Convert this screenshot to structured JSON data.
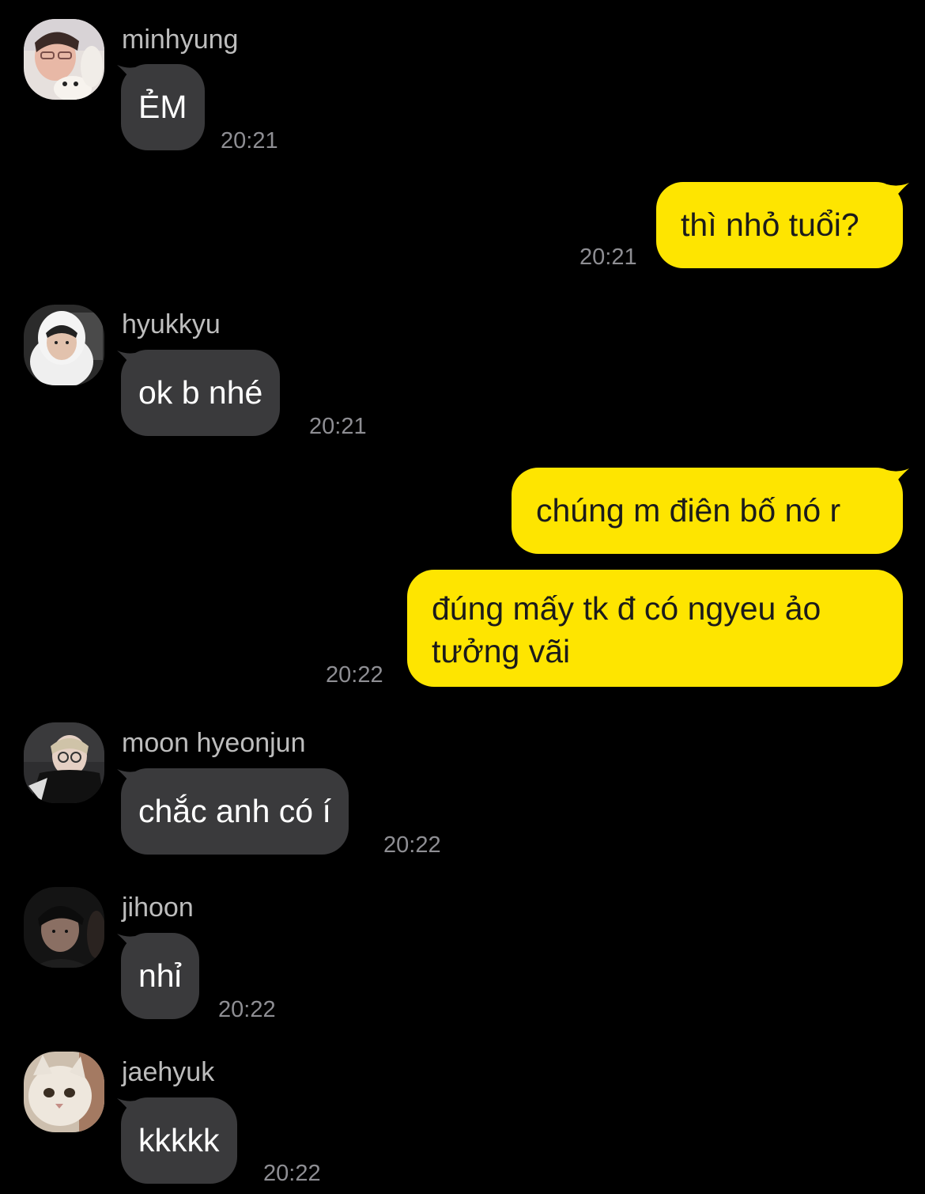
{
  "messages": [
    {
      "sender": "minhyung",
      "text": "ẺM",
      "time": "20:21"
    },
    {
      "text": "thì nhỏ tuổi?",
      "time": "20:21"
    },
    {
      "sender": "hyukkyu",
      "text": "ok b nhé",
      "time": "20:21"
    },
    {
      "text": "chúng m điên bố nó r"
    },
    {
      "text": "đúng mấy tk đ có ngyeu ảo tưởng vãi",
      "time": "20:22"
    },
    {
      "sender": "moon hyeonjun",
      "text": "chắc anh có í",
      "time": "20:22"
    },
    {
      "sender": "jihoon",
      "text": "nhỉ",
      "time": "20:22"
    },
    {
      "sender": "jaehyuk",
      "text": "kkkkk",
      "time": "20:22"
    }
  ],
  "colors": {
    "background": "#000000",
    "incoming_bubble": "#3a3a3c",
    "outgoing_bubble": "#fee500",
    "timestamp": "#8e8e93",
    "sender_name": "#bdbdbd"
  }
}
